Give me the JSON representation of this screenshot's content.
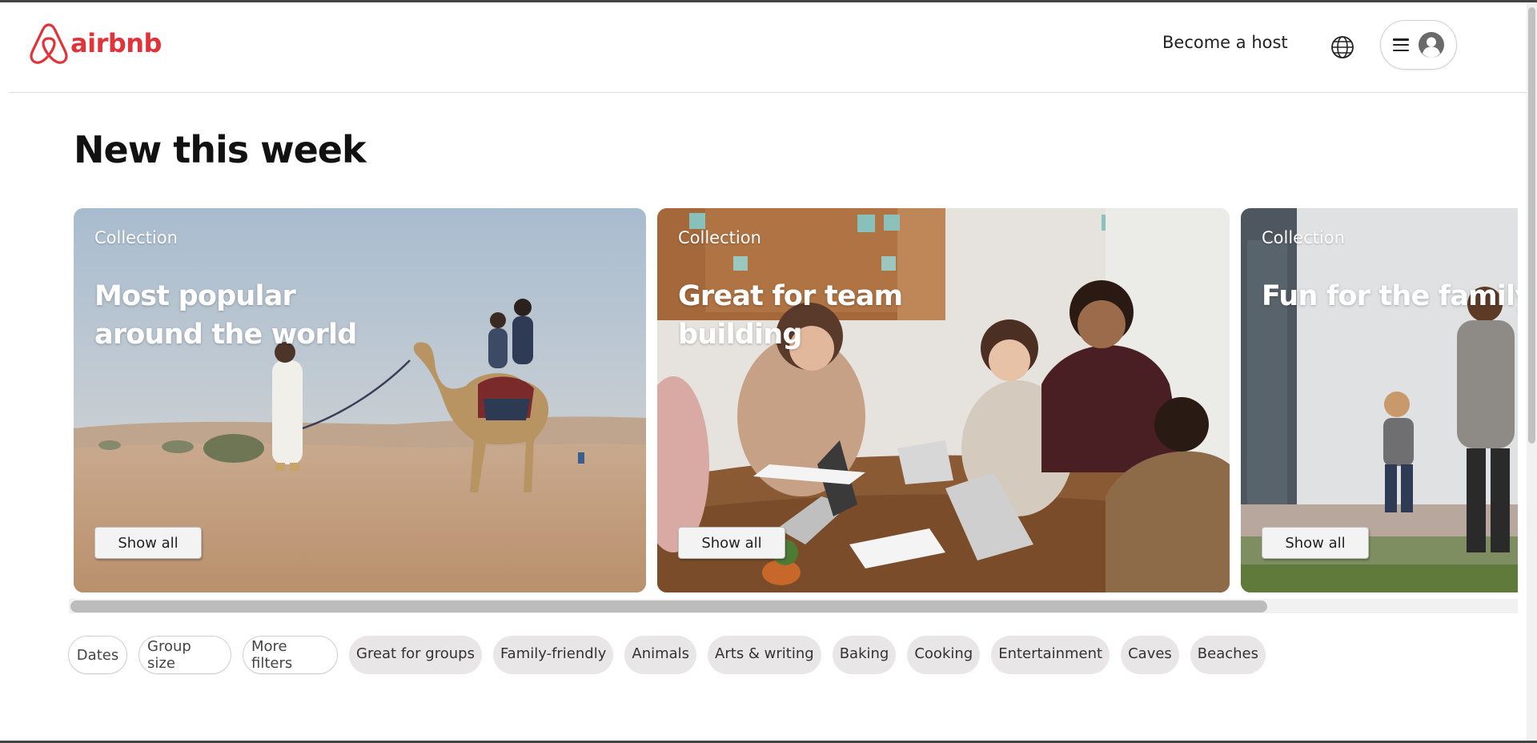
{
  "brand": {
    "name": "airbnb",
    "color": "#e0343a"
  },
  "header": {
    "host_link": "Become a host",
    "globe_icon": "globe-icon",
    "menu_icon": "hamburger-menu-icon",
    "avatar_icon": "user-avatar-icon"
  },
  "main": {
    "title": "New this week",
    "cards": [
      {
        "tag": "Collection",
        "title": "Most popular around the world",
        "button": "Show all"
      },
      {
        "tag": "Collection",
        "title": "Great for team building",
        "button": "Show all"
      },
      {
        "tag": "Collection",
        "title": "Fun for the family",
        "button": "Show all"
      }
    ]
  },
  "filters": {
    "outlined": [
      "Dates",
      "Group size",
      "More filters"
    ],
    "categories": [
      "Great for groups",
      "Family-friendly",
      "Animals",
      "Arts & writing",
      "Baking",
      "Cooking",
      "Entertainment",
      "Caves",
      "Beaches"
    ]
  }
}
